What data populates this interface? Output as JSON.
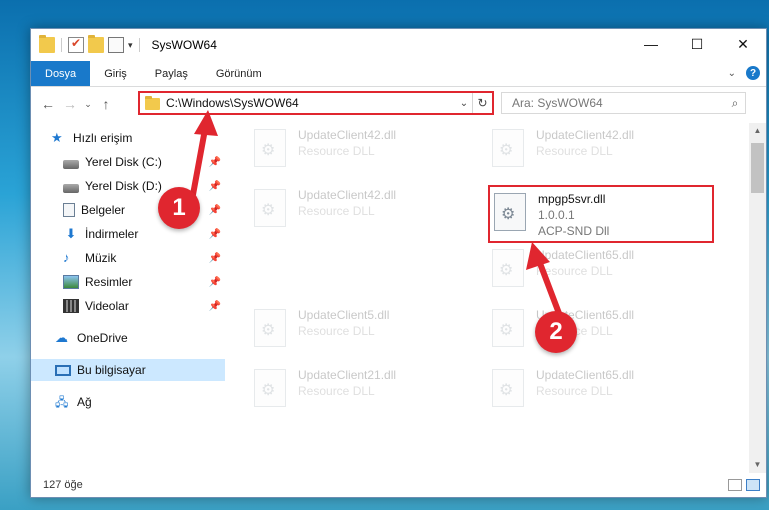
{
  "window": {
    "title": "SysWOW64",
    "controls": {
      "minimize": "—",
      "maximize": "☐",
      "close": "✕"
    }
  },
  "ribbon": {
    "tabs": [
      "Dosya",
      "Giriş",
      "Paylaş",
      "Görünüm"
    ],
    "help": "?"
  },
  "address": {
    "path": "C:\\Windows\\SysWOW64"
  },
  "search": {
    "placeholder": "Ara: SysWOW64"
  },
  "sidebar": {
    "items": [
      {
        "label": "Hızlı erişim",
        "icon": "star-icon"
      },
      {
        "label": "Yerel Disk (C:)",
        "icon": "drive-icon",
        "pinned": true
      },
      {
        "label": "Yerel Disk (D:)",
        "icon": "drive-icon",
        "pinned": true
      },
      {
        "label": "Belgeler",
        "icon": "document-icon",
        "pinned": true
      },
      {
        "label": "İndirmeler",
        "icon": "download-icon",
        "pinned": true
      },
      {
        "label": "Müzik",
        "icon": "music-icon",
        "pinned": true
      },
      {
        "label": "Resimler",
        "icon": "pictures-icon",
        "pinned": true
      },
      {
        "label": "Videolar",
        "icon": "video-icon",
        "pinned": true
      },
      {
        "label": "OneDrive",
        "icon": "cloud-icon"
      },
      {
        "label": "Bu bilgisayar",
        "icon": "computer-icon",
        "selected": true
      },
      {
        "label": "Ağ",
        "icon": "network-icon"
      }
    ]
  },
  "files": {
    "items": [
      {
        "name": "UpdateClient42.dll",
        "type": "Resource DLL",
        "faded": true
      },
      {
        "name": "UpdateClient42.dll",
        "type": "Resource DLL",
        "faded": true
      },
      {
        "name": "UpdateClient42.dll",
        "type": "Resource DLL",
        "faded": true
      },
      {
        "name": "mpgp5svr.dll",
        "version": "1.0.0.1",
        "type": "ACP-SND Dll",
        "highlighted": true
      },
      {
        "name": "UpdateClient5.dll",
        "type": "Resource DLL",
        "faded": true
      },
      {
        "name": "UpdateClient65.dll",
        "type": "Resource DLL",
        "faded": true
      },
      {
        "name": "UpdateClient21.dll",
        "type": "Resource DLL",
        "faded": true
      },
      {
        "name": "UpdateClient65.dll",
        "type": "Resource DLL",
        "faded": true
      },
      {
        "name": "UpdateClient65.dll",
        "type": "Resource DLL",
        "faded": true
      }
    ]
  },
  "status": {
    "count": "127 öğe"
  },
  "annotations": {
    "step1": "1",
    "step2": "2",
    "color": "#e0262f"
  }
}
